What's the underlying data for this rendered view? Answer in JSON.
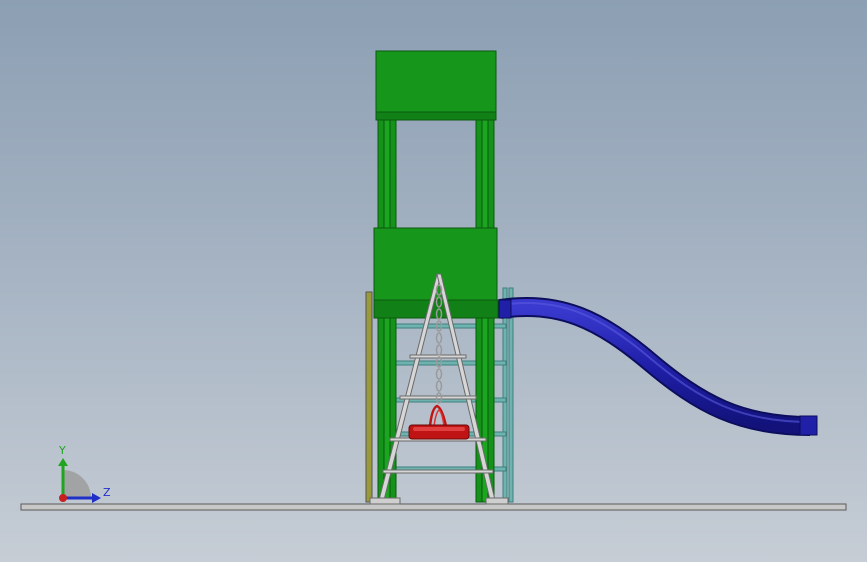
{
  "viewport": {
    "background_top": "#8c9fb3",
    "background_bottom": "#c6cdd5"
  },
  "model": {
    "components": [
      "ground-plane",
      "tower-roof",
      "tower-posts",
      "tower-deck",
      "a-frame-ladder",
      "hanging-chain",
      "swing-seat",
      "rear-rail",
      "slide-tube"
    ],
    "colors": {
      "structure_green": "#15921a",
      "rail_teal": "#6fb3b0",
      "slide_blue": "#1f1fa8",
      "seat_red": "#c01414",
      "ladder_silver": "#d6d6d6",
      "ground": "#c8c8c8"
    }
  },
  "triad": {
    "y_label": "Y",
    "z_label": "Z",
    "y_color": "#1fa51f",
    "z_color": "#1f2fc8",
    "x_color": "#c81f1f"
  }
}
